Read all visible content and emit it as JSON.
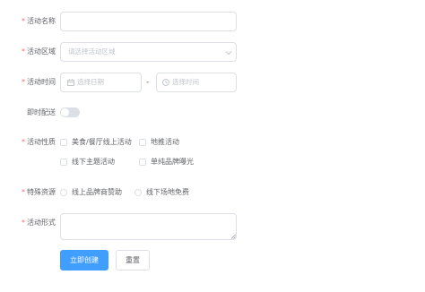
{
  "form": {
    "name": {
      "label": "活动名称",
      "required": "*",
      "value": ""
    },
    "region": {
      "label": "活动区域",
      "required": "*",
      "placeholder": "请选择活动区域"
    },
    "time": {
      "label": "活动时间",
      "required": "*",
      "date_placeholder": "选择日期",
      "separator": "-",
      "time_placeholder": "选择时间"
    },
    "delivery": {
      "label": "即时配送",
      "on": false
    },
    "type": {
      "label": "活动性质",
      "required": "*",
      "options": [
        "美食/餐厅线上活动",
        "地推活动",
        "线下主题活动",
        "单纯品牌曝光"
      ]
    },
    "resource": {
      "label": "特殊资源",
      "required": "*",
      "options": [
        "线上品牌商赞助",
        "线下场地免费"
      ]
    },
    "desc": {
      "label": "活动形式",
      "required": "*",
      "value": ""
    },
    "buttons": {
      "submit": "立即创建",
      "reset": "重置"
    }
  }
}
